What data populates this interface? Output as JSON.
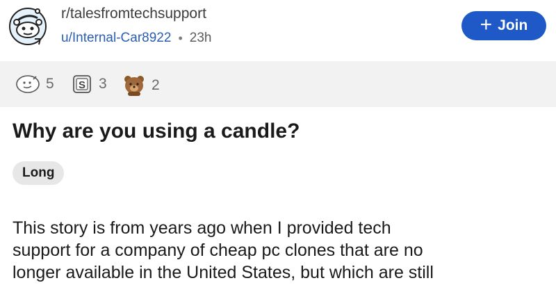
{
  "post": {
    "subreddit": "r/talesfromtechsupport",
    "username": "u/Internal-Car8922",
    "separator": "•",
    "time_ago": "23h",
    "join_label": "Join",
    "title": "Why are you using a candle?",
    "flair": "Long",
    "body_lines": [
      "This story is from years ago when I provided tech",
      "support for a company of cheap pc clones that are no",
      "longer available in the United States, but which are still"
    ]
  },
  "awards": [
    {
      "icon": "helpful-award-icon",
      "count": "5"
    },
    {
      "icon": "silver-award-icon",
      "count": "3"
    },
    {
      "icon": "bear-award-icon",
      "count": "2"
    }
  ],
  "colors": {
    "join_button": "#1f59c7",
    "username": "#2a5db0",
    "awards_bar": "#f2f2f2",
    "flair_bg": "#e7e7e7"
  }
}
